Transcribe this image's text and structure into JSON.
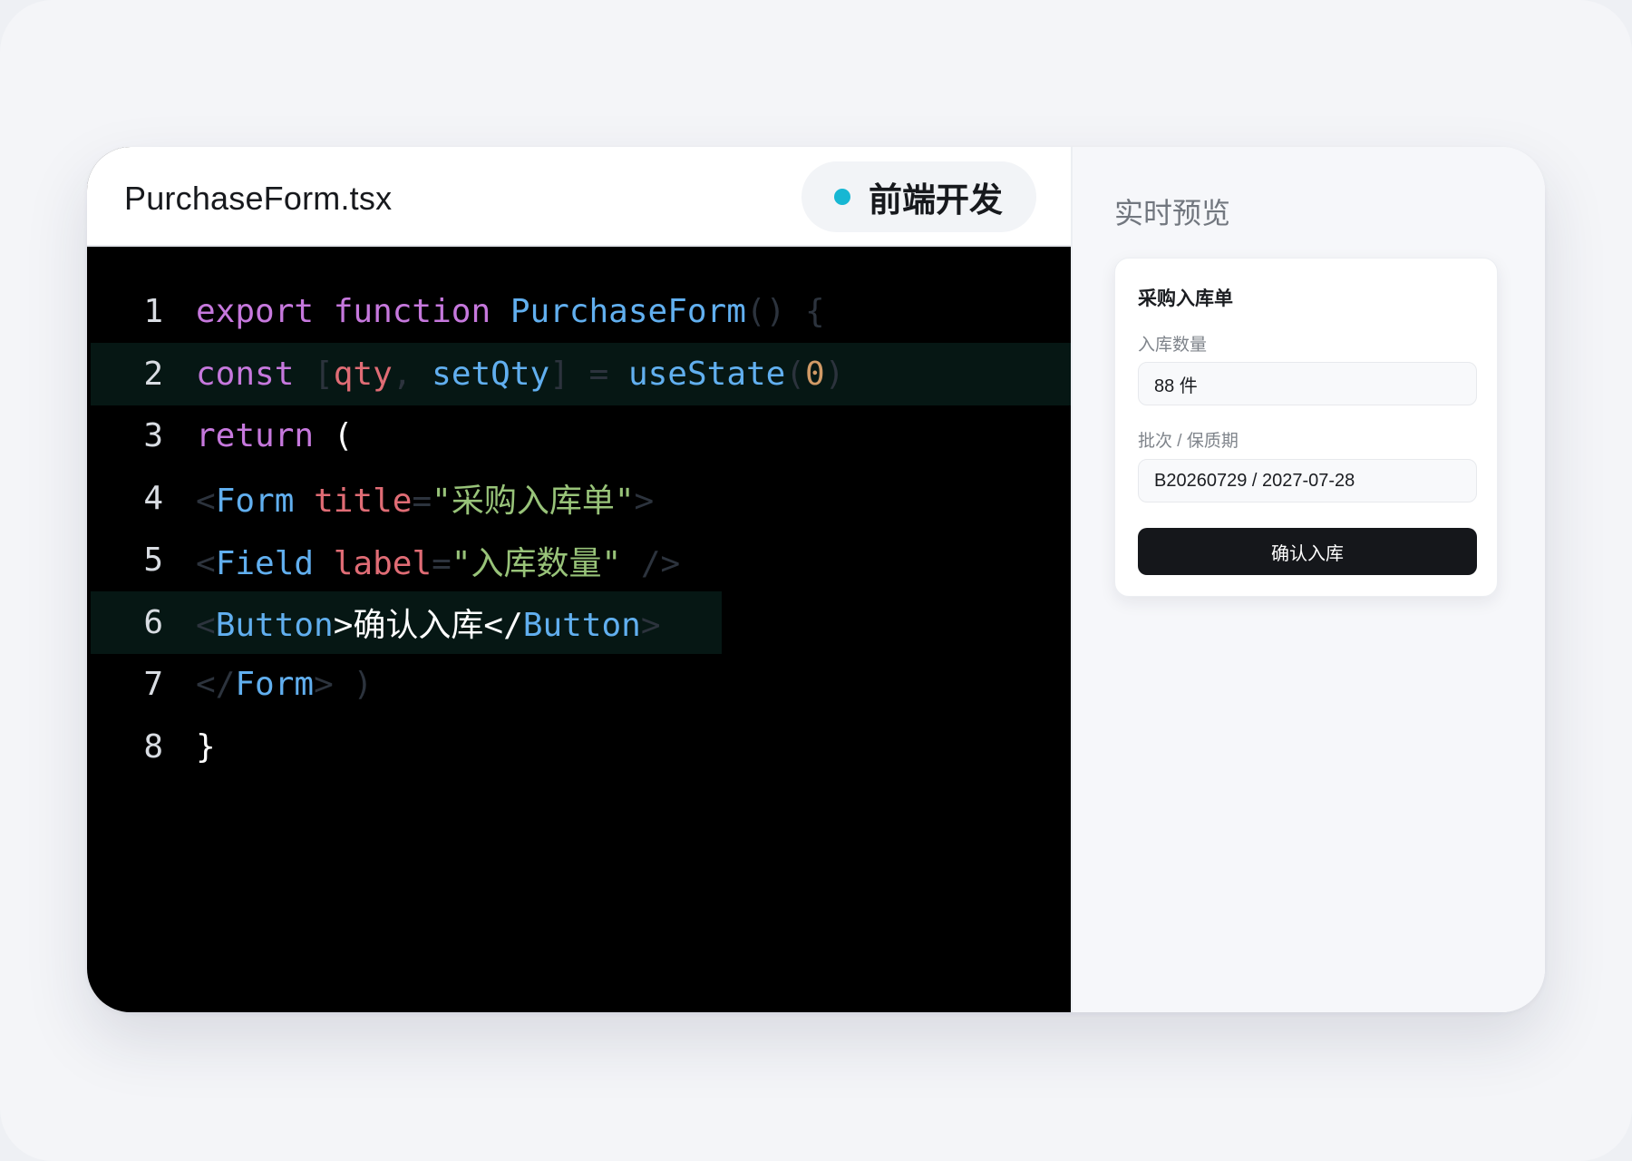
{
  "editor": {
    "file_name": "PurchaseForm.tsx",
    "role_badge": "前端开发",
    "lines": [
      {
        "number": "1",
        "tokens": [
          {
            "t": "export",
            "c": "kw"
          },
          {
            "t": " ",
            "c": "txt"
          },
          {
            "t": "function",
            "c": "kw"
          },
          {
            "t": " ",
            "c": "txt"
          },
          {
            "t": "PurchaseForm",
            "c": "fn"
          },
          {
            "t": "()",
            "c": "pun"
          },
          {
            "t": " ",
            "c": "txt"
          },
          {
            "t": "{",
            "c": "pun"
          }
        ]
      },
      {
        "number": "2",
        "highlight": "full",
        "tokens": [
          {
            "t": "const",
            "c": "kw"
          },
          {
            "t": " ",
            "c": "txt"
          },
          {
            "t": "[",
            "c": "pun"
          },
          {
            "t": "qty",
            "c": "var"
          },
          {
            "t": ",",
            "c": "pun"
          },
          {
            "t": " ",
            "c": "txt"
          },
          {
            "t": "setQty",
            "c": "fn"
          },
          {
            "t": "]",
            "c": "pun"
          },
          {
            "t": " ",
            "c": "txt"
          },
          {
            "t": "=",
            "c": "pun"
          },
          {
            "t": " ",
            "c": "txt"
          },
          {
            "t": "useState",
            "c": "fn"
          },
          {
            "t": "(",
            "c": "pun"
          },
          {
            "t": "0",
            "c": "num"
          },
          {
            "t": ")",
            "c": "pun"
          }
        ]
      },
      {
        "number": "3",
        "tokens": [
          {
            "t": "return",
            "c": "kw"
          },
          {
            "t": " (",
            "c": "txt"
          }
        ]
      },
      {
        "number": "4",
        "tokens": [
          {
            "t": "<",
            "c": "pun"
          },
          {
            "t": "Form",
            "c": "tag"
          },
          {
            "t": " ",
            "c": "txt"
          },
          {
            "t": "title",
            "c": "attr"
          },
          {
            "t": "=",
            "c": "pun"
          },
          {
            "t": "\"采购入库单\"",
            "c": "str"
          },
          {
            "t": ">",
            "c": "pun"
          }
        ]
      },
      {
        "number": "5",
        "tokens": [
          {
            "t": "<",
            "c": "pun"
          },
          {
            "t": "Field",
            "c": "tag"
          },
          {
            "t": " ",
            "c": "txt"
          },
          {
            "t": "label",
            "c": "attr"
          },
          {
            "t": "=",
            "c": "pun"
          },
          {
            "t": "\"入库数量\"",
            "c": "str"
          },
          {
            "t": " ",
            "c": "txt"
          },
          {
            "t": "/>",
            "c": "pun"
          }
        ]
      },
      {
        "number": "6",
        "highlight": "partial",
        "tokens": [
          {
            "t": "<",
            "c": "pun"
          },
          {
            "t": "Button",
            "c": "tag"
          },
          {
            "t": ">确认入库</",
            "c": "txt"
          },
          {
            "t": "Button",
            "c": "tag"
          },
          {
            "t": ">",
            "c": "pun"
          }
        ]
      },
      {
        "number": "7",
        "tokens": [
          {
            "t": "</",
            "c": "pun"
          },
          {
            "t": "Form",
            "c": "tag"
          },
          {
            "t": ">",
            "c": "pun"
          },
          {
            "t": " ",
            "c": "txt"
          },
          {
            "t": ")",
            "c": "pun"
          }
        ]
      },
      {
        "number": "8",
        "tokens": [
          {
            "t": "}",
            "c": "txt"
          }
        ]
      }
    ]
  },
  "preview": {
    "title": "实时预览",
    "card": {
      "title": "采购入库单",
      "quantity_label": "入库数量",
      "quantity_value": "88 件",
      "batch_label": "批次 / 保质期",
      "batch_value": "B20260729 / 2027-07-28",
      "confirm_label": "确认入库"
    }
  },
  "colors": {
    "status_dot": "#17b7d3",
    "keyword": "#c678dd",
    "function": "#61afef",
    "variable": "#e06c75",
    "string": "#98c379",
    "number": "#d19a66",
    "button": "#15171b"
  }
}
